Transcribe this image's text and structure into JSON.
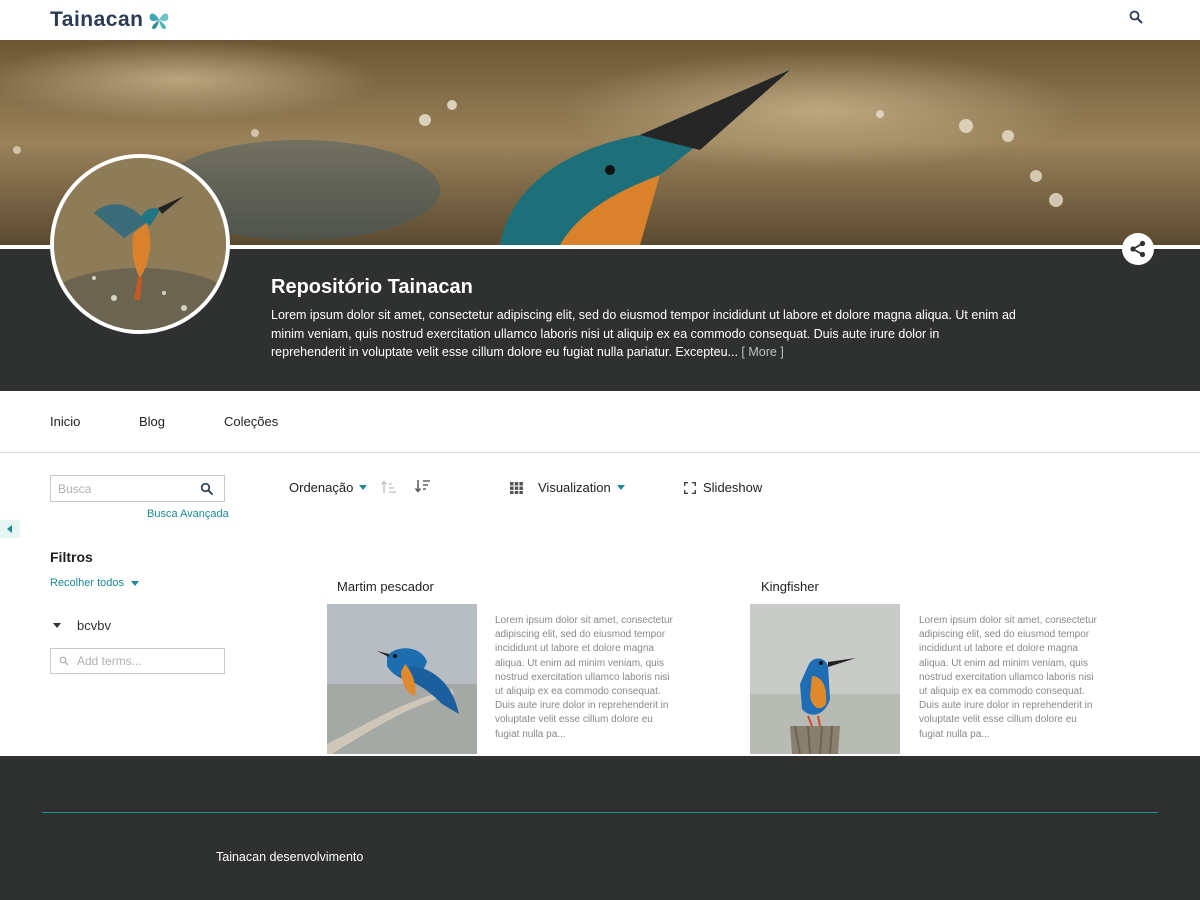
{
  "header": {
    "logo_text": "Tainacan",
    "search_icon": "search-icon"
  },
  "repository": {
    "title": "Repositório Tainacan",
    "description": "Lorem ipsum dolor sit amet, consectetur adipiscing elit, sed do eiusmod tempor incididunt ut labore et dolore magna aliqua. Ut enim ad minim veniam, quis nostrud exercitation ullamco laboris nisi ut aliquip ex ea commodo consequat. Duis aute irure dolor in reprehenderit in voluptate velit esse cillum dolore eu fugiat nulla pariatur. Excepteu...",
    "more_label": "[ More ]",
    "share_icon": "share-icon"
  },
  "nav": {
    "items": [
      {
        "label": "Inicio"
      },
      {
        "label": "Blog"
      },
      {
        "label": "Coleções"
      }
    ]
  },
  "sidebar": {
    "search_placeholder": "Busca",
    "advanced_search_label": "Busca Avançada",
    "filters_title": "Filtros",
    "collapse_all_label": "Recolher todos",
    "filter_name": "bcvbv",
    "terms_placeholder": "Add terms..."
  },
  "toolbar": {
    "sort_label": "Ordenação",
    "view_label": "Visualization",
    "slideshow_label": "Slideshow"
  },
  "items": [
    {
      "title": "Martim pescador",
      "description": "Lorem ipsum dolor sit amet, consectetur adipiscing elit, sed do eiusmod tempor incididunt ut labore et dolore magna aliqua. Ut enim ad minim veniam, quis nostrud exercitation ullamco laboris nisi ut aliquip ex ea commodo consequat. Duis aute irure dolor in reprehenderit in voluptate velit esse cillum dolore eu fugiat nulla pa..."
    },
    {
      "title": "Kingfisher",
      "description": "Lorem ipsum dolor sit amet, consectetur adipiscing elit, sed do eiusmod tempor incididunt ut labore et dolore magna aliqua. Ut enim ad minim veniam, quis nostrud exercitation ullamco laboris nisi ut aliquip ex ea commodo consequat. Duis aute irure dolor in reprehenderit in voluptate velit esse cillum dolore eu fugiat nulla pa..."
    }
  ],
  "footer": {
    "text": "Tainacan desenvolvimento"
  },
  "colors": {
    "accent": "#1a8a93",
    "dark_band": "#2f3131",
    "logo": "#2b3a55"
  }
}
